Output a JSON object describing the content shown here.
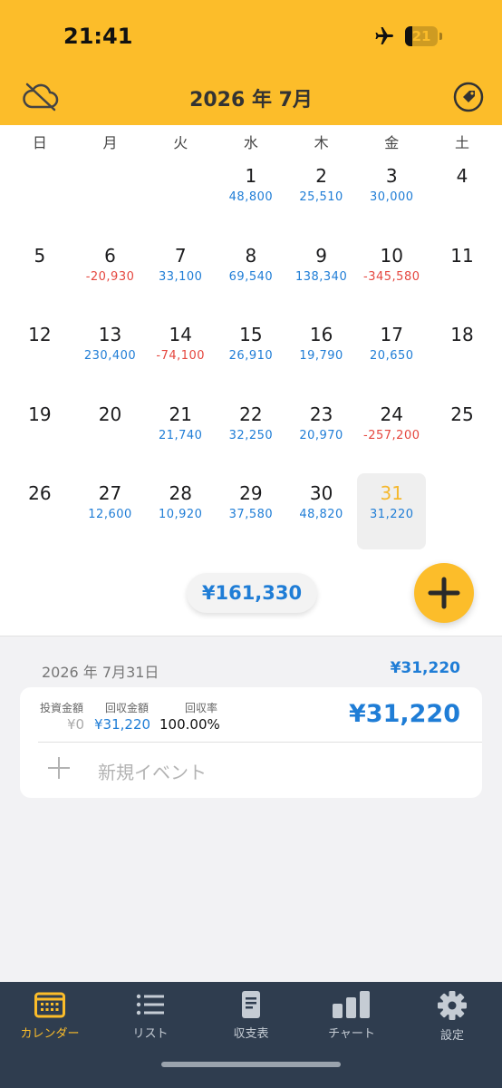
{
  "status": {
    "time": "21:41",
    "battery": "21",
    "battery_level": 0.21
  },
  "header": {
    "title": "2026 年 7月"
  },
  "weekdays": [
    "日",
    "月",
    "火",
    "水",
    "木",
    "金",
    "土"
  ],
  "calendar": {
    "weeks": [
      [
        {
          "day": "",
          "amount": "",
          "sign": ""
        },
        {
          "day": "",
          "amount": "",
          "sign": ""
        },
        {
          "day": "",
          "amount": "",
          "sign": ""
        },
        {
          "day": "1",
          "amount": "48,800",
          "sign": "pos"
        },
        {
          "day": "2",
          "amount": "25,510",
          "sign": "pos"
        },
        {
          "day": "3",
          "amount": "30,000",
          "sign": "pos"
        },
        {
          "day": "4",
          "amount": "",
          "sign": ""
        }
      ],
      [
        {
          "day": "5",
          "amount": "",
          "sign": ""
        },
        {
          "day": "6",
          "amount": "-20,930",
          "sign": "neg"
        },
        {
          "day": "7",
          "amount": "33,100",
          "sign": "pos"
        },
        {
          "day": "8",
          "amount": "69,540",
          "sign": "pos"
        },
        {
          "day": "9",
          "amount": "138,340",
          "sign": "pos"
        },
        {
          "day": "10",
          "amount": "-345,580",
          "sign": "neg"
        },
        {
          "day": "11",
          "amount": "",
          "sign": ""
        }
      ],
      [
        {
          "day": "12",
          "amount": "",
          "sign": ""
        },
        {
          "day": "13",
          "amount": "230,400",
          "sign": "pos"
        },
        {
          "day": "14",
          "amount": "-74,100",
          "sign": "neg"
        },
        {
          "day": "15",
          "amount": "26,910",
          "sign": "pos"
        },
        {
          "day": "16",
          "amount": "19,790",
          "sign": "pos"
        },
        {
          "day": "17",
          "amount": "20,650",
          "sign": "pos"
        },
        {
          "day": "18",
          "amount": "",
          "sign": ""
        }
      ],
      [
        {
          "day": "19",
          "amount": "",
          "sign": ""
        },
        {
          "day": "20",
          "amount": "",
          "sign": ""
        },
        {
          "day": "21",
          "amount": "21,740",
          "sign": "pos"
        },
        {
          "day": "22",
          "amount": "32,250",
          "sign": "pos"
        },
        {
          "day": "23",
          "amount": "20,970",
          "sign": "pos"
        },
        {
          "day": "24",
          "amount": "-257,200",
          "sign": "neg"
        },
        {
          "day": "25",
          "amount": "",
          "sign": ""
        }
      ],
      [
        {
          "day": "26",
          "amount": "",
          "sign": ""
        },
        {
          "day": "27",
          "amount": "12,600",
          "sign": "pos"
        },
        {
          "day": "28",
          "amount": "10,920",
          "sign": "pos"
        },
        {
          "day": "29",
          "amount": "37,580",
          "sign": "pos"
        },
        {
          "day": "30",
          "amount": "48,820",
          "sign": "pos"
        },
        {
          "day": "31",
          "amount": "31,220",
          "sign": "pos",
          "selected": true
        },
        {
          "day": "",
          "amount": "",
          "sign": ""
        }
      ]
    ]
  },
  "month_total": "¥161,330",
  "detail": {
    "date": "2026 年 7月31日",
    "total": "¥31,220",
    "invest_label": "投資金額",
    "invest_value": "¥0",
    "return_label": "回収金額",
    "return_value": "¥31,220",
    "rate_label": "回収率",
    "rate_value": "100.00%",
    "big_value": "¥31,220",
    "new_event_label": "新規イベント"
  },
  "tabs": [
    {
      "label": "カレンダー",
      "icon": "calendar-icon",
      "active": true
    },
    {
      "label": "リスト",
      "icon": "list-icon",
      "active": false
    },
    {
      "label": "収支表",
      "icon": "document-icon",
      "active": false
    },
    {
      "label": "チャート",
      "icon": "bar-chart-icon",
      "active": false
    },
    {
      "label": "設定",
      "icon": "gear-icon",
      "active": false
    }
  ],
  "colors": {
    "accent": "#fcbd2a",
    "positive": "#1f7dd6",
    "negative": "#e5473f",
    "tabbar": "#2f3d4f"
  }
}
